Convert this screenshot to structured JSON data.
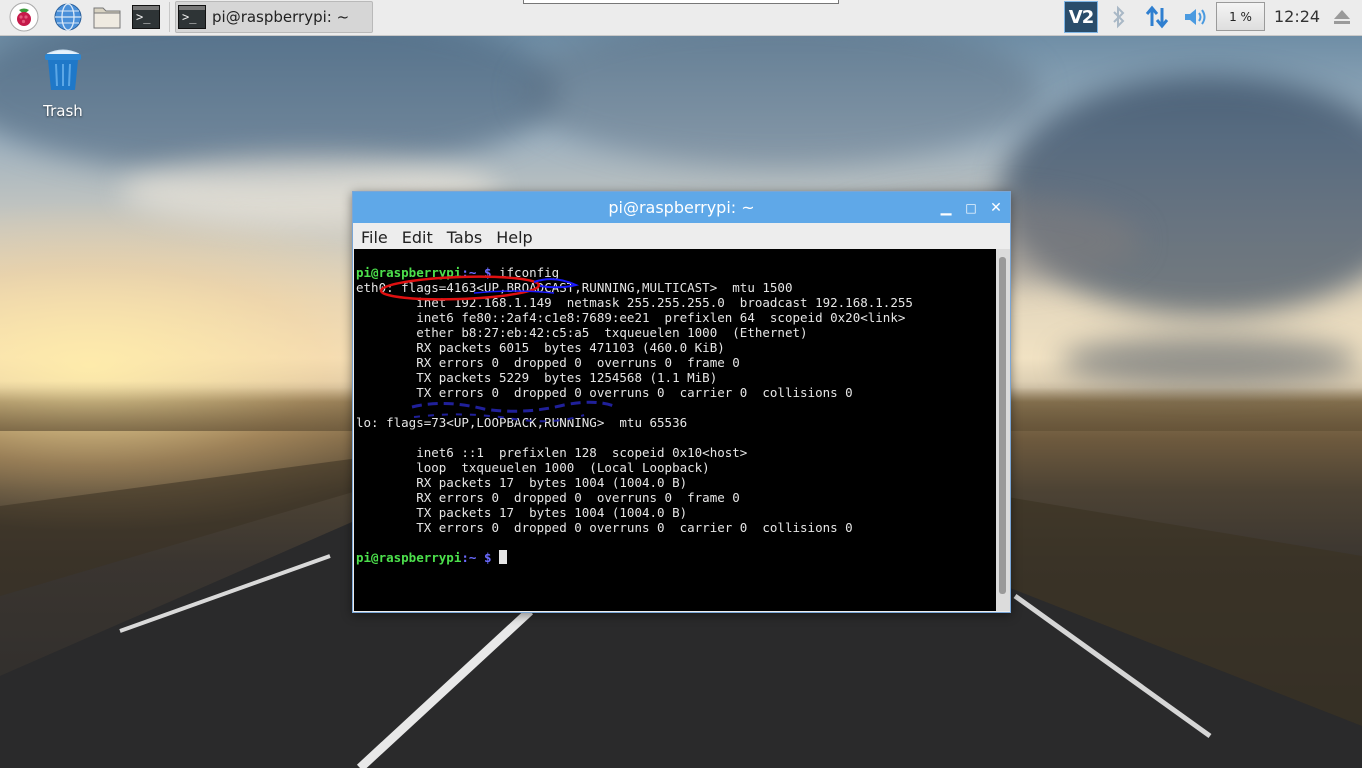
{
  "taskbar": {
    "launchers": [
      {
        "icon": "raspberry-menu-icon"
      },
      {
        "icon": "web-browser-icon"
      },
      {
        "icon": "file-manager-icon"
      },
      {
        "icon": "terminal-icon"
      }
    ],
    "task": {
      "label": "pi@raspberrypi: ~",
      "icon": "terminal-icon"
    },
    "tray": {
      "vnc": "V2",
      "cpu": "1 %",
      "clock": "12:24"
    }
  },
  "desktop": {
    "trash_label": "Trash"
  },
  "window": {
    "title": "pi@raspberrypi: ~",
    "menu": [
      "File",
      "Edit",
      "Tabs",
      "Help"
    ],
    "prompt_user": "pi@raspberrypi",
    "prompt_path": ":~",
    "prompt_symbol": " $ ",
    "command": "ifconfig",
    "lines": [
      "eth0: flags=4163<UP,BROADCAST,RUNNING,MULTICAST>  mtu 1500",
      "        inet 192.168.1.149  netmask 255.255.255.0  broadcast 192.168.1.255",
      "        inet6 fe80::2af4:c1e8:7689:ee21  prefixlen 64  scopeid 0x20<link>",
      "        ether b8:27:eb:42:c5:a5  txqueuelen 1000  (Ethernet)",
      "        RX packets 6015  bytes 471103 (460.0 KiB)",
      "        RX errors 0  dropped 0  overruns 0  frame 0",
      "        TX packets 5229  bytes 1254568 (1.1 MiB)",
      "        TX errors 0  dropped 0 overruns 0  carrier 0  collisions 0",
      "",
      "lo: flags=73<UP,LOOPBACK,RUNNING>  mtu 65536",
      "",
      "        inet6 ::1  prefixlen 128  scopeid 0x10<host>",
      "        loop  txqueuelen 1000  (Local Loopback)",
      "        RX packets 17  bytes 1004 (1004.0 B)",
      "        RX errors 0  dropped 0  overruns 0  frame 0",
      "        TX packets 17  bytes 1004 (1004.0 B)",
      "        TX errors 0  dropped 0 overruns 0  carrier 0  collisions 0",
      ""
    ]
  },
  "colors": {
    "titlebar": "#5fa8e8",
    "prompt_user": "#4ce04c",
    "prompt_path": "#6b6bff",
    "annotation_circle": "#e01010",
    "annotation_scribble": "#1a1aff"
  }
}
